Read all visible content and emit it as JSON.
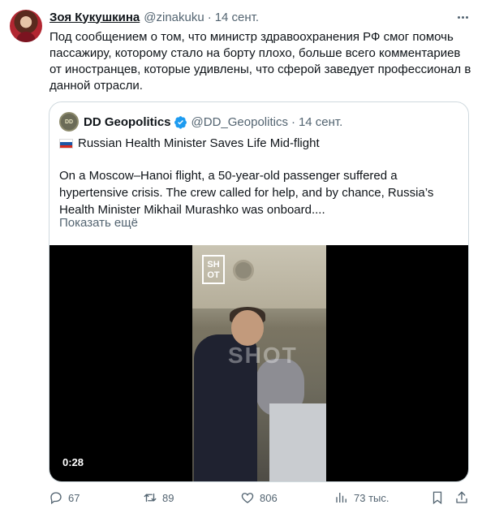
{
  "tweet": {
    "author_name": "Зоя Кукушкина",
    "author_handle": "@zinakuku",
    "separator": "·",
    "time": "14 сент.",
    "text": "Под сообщением о том, что министр здравоохранения РФ смог помочь пассажиру, которому стало на борту плохо, больше всего комментариев от иностранцев, которые удивлены, что сферой заведует профессионал в данной отрасли."
  },
  "quote": {
    "avatar_text": "DD",
    "author_name": "DD Geopolitics",
    "author_handle": "@DD_Geopolitics",
    "separator": "·",
    "time": "14 сент.",
    "title": "Russian Health Minister Saves Life Mid-flight",
    "body": "On a Moscow–Hanoi flight, a 50-year-old passenger suffered a hypertensive crisis. The crew called for help, and by chance, Russia’s Health Minister Mikhail Murashko was onboard....",
    "show_more": "Показать ещё",
    "video": {
      "logo_text": "SH\nOT",
      "watermark": "SHOT",
      "duration": "0:28"
    }
  },
  "actions": {
    "replies": "67",
    "retweets": "89",
    "likes": "806",
    "views": "73 тыс."
  },
  "colors": {
    "text": "#0f1419",
    "secondary": "#536471",
    "border": "#cfd9de",
    "verified": "#1d9bf0"
  },
  "icons": {
    "reply": "reply-icon",
    "retweet": "retweet-icon",
    "like": "heart-icon",
    "views": "views-icon",
    "bookmark": "bookmark-icon",
    "share": "share-icon",
    "more": "more-icon",
    "verified": "verified-badge-icon",
    "flag": "russia-flag-icon"
  }
}
